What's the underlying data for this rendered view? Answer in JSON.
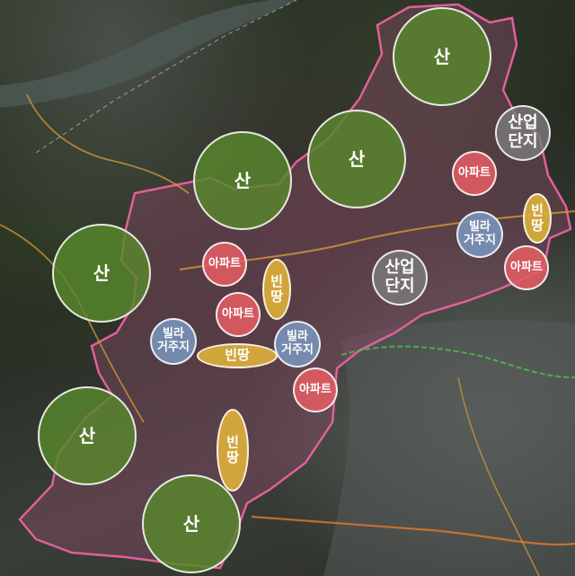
{
  "map": {
    "boundary_color": "#e0609a",
    "district_tint": "#8a4a6a"
  },
  "labels": {
    "mountain": "산",
    "industrial": "산업\n단지",
    "apartment": "아파트",
    "villa": "빌라\n거주지",
    "vacant_h": "빈땅",
    "vacant_v": "빈\n땅"
  },
  "legend_colors": {
    "mountain": "#58872c",
    "industrial": "#7a7a7a",
    "apartment": "#e25c62",
    "villa": "#7a94bc",
    "vacant": "#deb03a"
  }
}
